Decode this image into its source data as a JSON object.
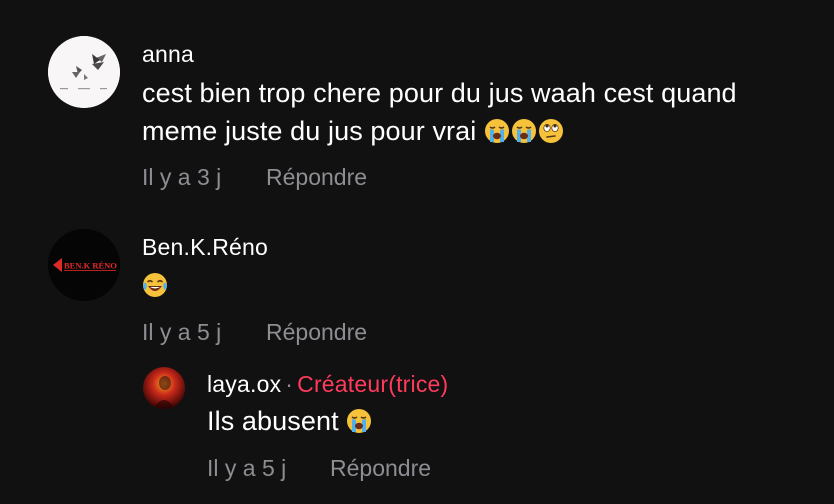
{
  "comments": [
    {
      "username": "anna",
      "text": "cest bien trop chere pour du jus waah cest quand meme juste du jus pour vrai",
      "emojis": [
        "loudly-crying-face",
        "loudly-crying-face",
        "face-with-rolling-eyes"
      ],
      "time": "Il y a 3 j",
      "reply_label": "Répondre",
      "avatar": "butterfly-avatar"
    },
    {
      "username": "Ben.K.Réno",
      "text": "",
      "emojis": [
        "face-with-tears-of-joy"
      ],
      "time": "Il y a 5 j",
      "reply_label": "Répondre",
      "avatar": "benk-reno-logo",
      "avatar_text": "BEN.K RÉNO"
    }
  ],
  "reply": {
    "username": "laya.ox",
    "separator": "·",
    "badge": "Créateur(trice)",
    "text": "Ils abusent",
    "emojis": [
      "loudly-crying-face"
    ],
    "time": "Il y a 5 j",
    "reply_label": "Répondre",
    "avatar": "red-photo-avatar"
  },
  "colors": {
    "background": "#111112",
    "meta": "#8d8d92",
    "creator": "#ff3b5c"
  }
}
